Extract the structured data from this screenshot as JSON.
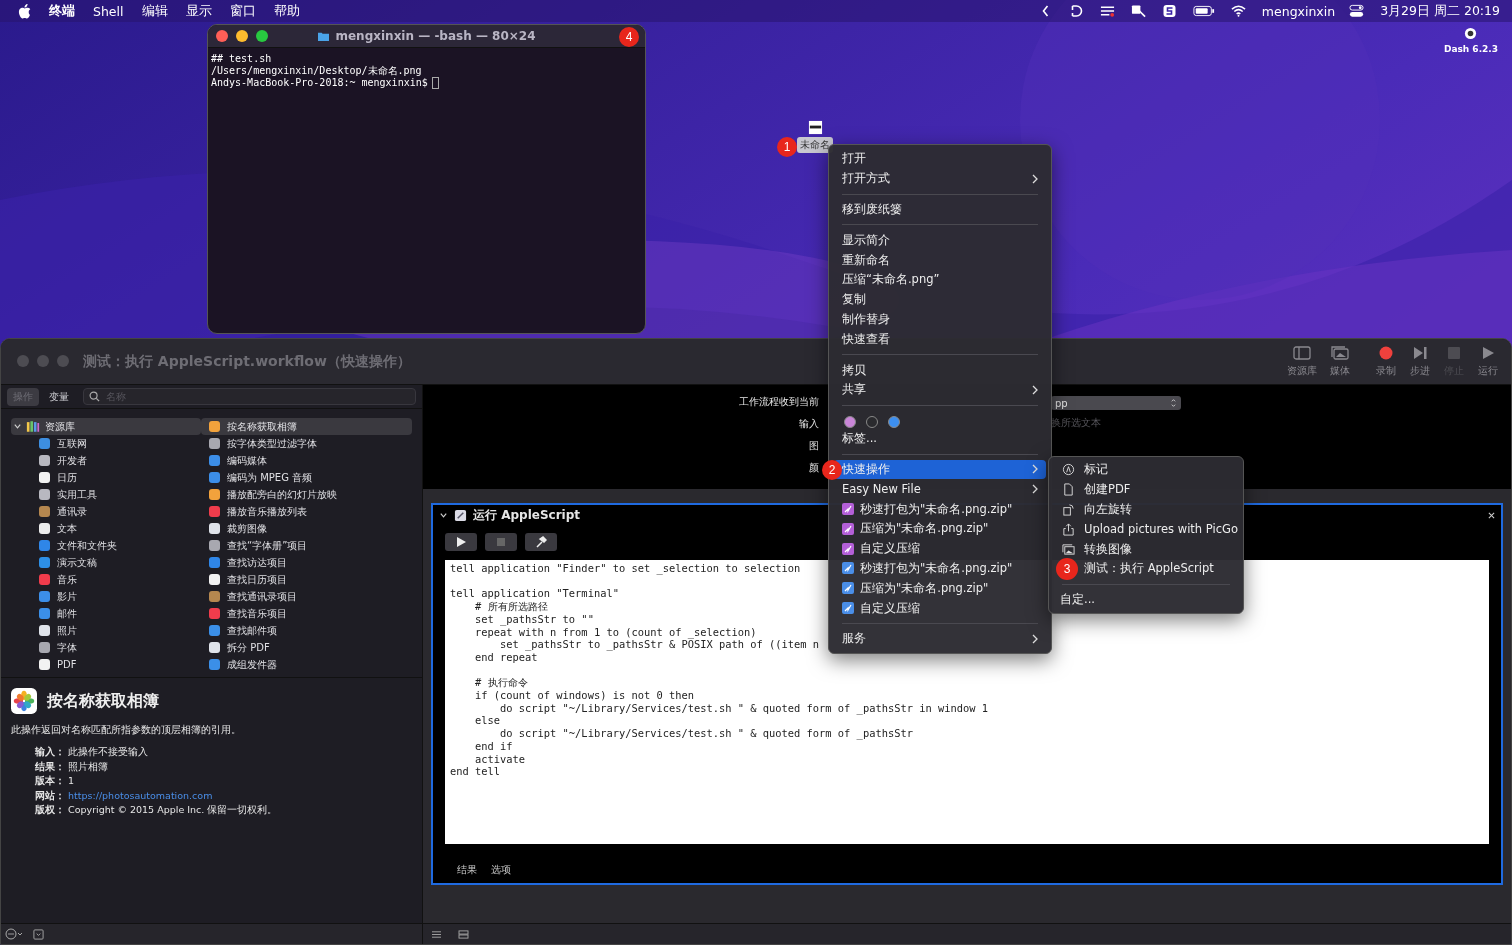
{
  "menu_bar": {
    "app_name": "终端",
    "menus": [
      "Shell",
      "编辑",
      "显示",
      "窗口",
      "帮助"
    ],
    "user": "mengxinxin",
    "datetime": "3月29日 周二  20:19"
  },
  "desktop_widget": {
    "label": "Dash 6.2.3"
  },
  "desktop_file": {
    "label": "未命名",
    "badge": "1"
  },
  "terminal": {
    "title": "mengxinxin — -bash — 80×24",
    "badge": "4",
    "lines": [
      "## test.sh",
      "/Users/mengxinxin/Desktop/未命名.png",
      "Andys-MacBook-Pro-2018:~ mengxinxin$"
    ]
  },
  "automator": {
    "title": "测试：执行 AppleScript.workflow（快速操作）",
    "toolbar": [
      {
        "label": "资源库",
        "kind": "sidebar",
        "disabled": false
      },
      {
        "label": "媒体",
        "kind": "media",
        "disabled": false
      },
      {
        "label": "录制",
        "kind": "record",
        "disabled": false
      },
      {
        "label": "步进",
        "kind": "step",
        "disabled": false
      },
      {
        "label": "停止",
        "kind": "stop",
        "disabled": true
      },
      {
        "label": "运行",
        "kind": "run",
        "disabled": false
      }
    ],
    "tabs": [
      {
        "label": "操作",
        "selected": true
      },
      {
        "label": "变量",
        "selected": false
      }
    ],
    "search": {
      "placeholder": "名称"
    },
    "library": {
      "label": "资源库",
      "expanded": true,
      "selected": true,
      "children": [
        {
          "label": "互联网",
          "color": "#3d8ee0"
        },
        {
          "label": "开发者",
          "color": "#b8b8c0"
        },
        {
          "label": "日历",
          "color": "#f2f2f2"
        },
        {
          "label": "实用工具",
          "color": "#b8b8c0"
        },
        {
          "label": "通讯录",
          "color": "#b5874f"
        },
        {
          "label": "文本",
          "color": "#ececec"
        },
        {
          "label": "文件和文件夹",
          "color": "#2f86e8"
        },
        {
          "label": "演示文稿",
          "color": "#2d8fe6"
        },
        {
          "label": "音乐",
          "color": "#f03c4c"
        },
        {
          "label": "影片",
          "color": "#3c8ee8"
        },
        {
          "label": "邮件",
          "color": "#3b8fe8"
        },
        {
          "label": "照片",
          "color": "#dfe3ea"
        },
        {
          "label": "字体",
          "color": "#a8a8b0"
        },
        {
          "label": "PDF",
          "color": "#f2f2f2"
        }
      ]
    },
    "actions": [
      {
        "label": "按名称获取相簿",
        "selected": true,
        "color": "#f2a23c"
      },
      {
        "label": "按字体类型过滤字体",
        "selected": false,
        "color": "#a8a8b0"
      },
      {
        "label": "编码媒体",
        "selected": false,
        "color": "#3c8ee8"
      },
      {
        "label": "编码为 MPEG 音频",
        "selected": false,
        "color": "#3c8ee8"
      },
      {
        "label": "播放配旁白的幻灯片放映",
        "selected": false,
        "color": "#f2a23c"
      },
      {
        "label": "播放音乐播放列表",
        "selected": false,
        "color": "#f03c4c"
      },
      {
        "label": "裁剪图像",
        "selected": false,
        "color": "#dfe3ea"
      },
      {
        "label": "查找“字体册”项目",
        "selected": false,
        "color": "#a8a8b0"
      },
      {
        "label": "查找访达项目",
        "selected": false,
        "color": "#2f86e8"
      },
      {
        "label": "查找日历项目",
        "selected": false,
        "color": "#f2f2f2"
      },
      {
        "label": "查找通讯录项目",
        "selected": false,
        "color": "#b5874f"
      },
      {
        "label": "查找音乐项目",
        "selected": false,
        "color": "#f03c4c"
      },
      {
        "label": "查找邮件项",
        "selected": false,
        "color": "#3b8fe8"
      },
      {
        "label": "拆分 PDF",
        "selected": false,
        "color": "#dfe3ea"
      },
      {
        "label": "成组发件器",
        "selected": false,
        "color": "#3b8fe8"
      }
    ],
    "description": {
      "title": "按名称获取相簿",
      "summary": "此操作返回对名称匹配所指参数的顶层相簿的引用。",
      "fields": [
        {
          "label": "输入：",
          "value": "此操作不接受输入",
          "kind": "text"
        },
        {
          "label": "结果：",
          "value": "照片相簿",
          "kind": "text"
        },
        {
          "label": "版本：",
          "value": "1",
          "kind": "text"
        },
        {
          "label": "网站：",
          "value": "https://photosautomation.com",
          "kind": "link"
        },
        {
          "label": "版权：",
          "value": "Copyright © 2015 Apple Inc. 保留一切权利。",
          "kind": "text"
        }
      ]
    },
    "workflow_settings": {
      "labels": [
        "工作流程收到当前",
        "输入",
        "图",
        "颜"
      ],
      "popup_value": "pp",
      "option": "换所选文本"
    },
    "action": {
      "title": "运行 AppleScript",
      "expanded": true,
      "code_blocks": [
        [
          "tell application \"Finder\" to set _selection to selection"
        ],
        [
          "tell application \"Terminal\"",
          "    # 所有所选路径",
          "    set _pathsStr to \"\"",
          "    repeat with n from 1 to (count of _selection)",
          "        set _pathsStr to _pathsStr & POSIX path of ((item n",
          "    end repeat"
        ],
        [
          "    # 执行命令",
          "    if (count of windows) is not 0 then",
          "        do script \"~/Library/Services/test.sh \" & quoted form of _pathsStr in window 1",
          "    else",
          "        do script \"~/Library/Services/test.sh \" & quoted form of _pathsStr",
          "    end if",
          "    activate",
          "end tell"
        ]
      ],
      "tabs": [
        "结果",
        "选项"
      ]
    }
  },
  "context_menu": {
    "sections": [
      {
        "kind": "items",
        "items": [
          {
            "label": "打开",
            "submenu": false,
            "selected": false
          },
          {
            "label": "打开方式",
            "submenu": true,
            "selected": false
          }
        ]
      },
      {
        "kind": "items",
        "items": [
          {
            "label": "移到废纸篓",
            "submenu": false,
            "selected": false
          }
        ]
      },
      {
        "kind": "items",
        "items": [
          {
            "label": "显示简介",
            "submenu": false,
            "selected": false
          },
          {
            "label": "重新命名",
            "submenu": false,
            "selected": false
          },
          {
            "label": "压缩“未命名.png”",
            "submenu": false,
            "selected": false
          },
          {
            "label": "复制",
            "submenu": false,
            "selected": false
          },
          {
            "label": "制作替身",
            "submenu": false,
            "selected": false
          },
          {
            "label": "快速查看",
            "submenu": false,
            "selected": false
          }
        ]
      },
      {
        "kind": "items",
        "items": [
          {
            "label": "拷贝",
            "submenu": false,
            "selected": false
          },
          {
            "label": "共享",
            "submenu": true,
            "selected": false
          }
        ]
      },
      {
        "kind": "tags",
        "tags": [
          {
            "color": "#c985d8"
          },
          {
            "color": "#2a2a2e"
          },
          {
            "color": "#3d8ff0"
          }
        ],
        "items": [
          {
            "label": "标签...",
            "submenu": false,
            "selected": false
          }
        ]
      },
      {
        "kind": "items",
        "items": [
          {
            "label": "快速操作",
            "submenu": true,
            "selected": true,
            "badge": "2"
          },
          {
            "label": "Easy New File",
            "submenu": true,
            "selected": false
          },
          {
            "label": "秒速打包为\"未命名.png.zip\"",
            "submenu": false,
            "selected": false,
            "color": "#b45fd8"
          },
          {
            "label": "压缩为\"未命名.png.zip\"",
            "submenu": false,
            "selected": false,
            "color": "#b45fd8"
          },
          {
            "label": "自定义压缩",
            "submenu": false,
            "selected": false,
            "color": "#b45fd8"
          },
          {
            "label": "秒速打包为\"未命名.png.zip\"",
            "submenu": false,
            "selected": false,
            "color": "#4a8ee8"
          },
          {
            "label": "压缩为\"未命名.png.zip\"",
            "submenu": false,
            "selected": false,
            "color": "#4a8ee8"
          },
          {
            "label": "自定义压缩",
            "submenu": false,
            "selected": false,
            "color": "#4a8ee8"
          }
        ]
      },
      {
        "kind": "items",
        "items": [
          {
            "label": "服务",
            "submenu": true,
            "selected": false
          }
        ]
      }
    ]
  },
  "submenu": {
    "items": [
      {
        "label": "标记",
        "kind": "markup"
      },
      {
        "label": "创建PDF",
        "kind": "document"
      },
      {
        "label": "向左旋转",
        "kind": "rotate"
      },
      {
        "label": "Upload pictures with PicGo",
        "kind": "share"
      },
      {
        "label": "转换图像",
        "kind": "images"
      },
      {
        "label": "测试：执行 AppleScript",
        "kind": "badge",
        "badge": "3"
      }
    ],
    "footer": "自定..."
  }
}
